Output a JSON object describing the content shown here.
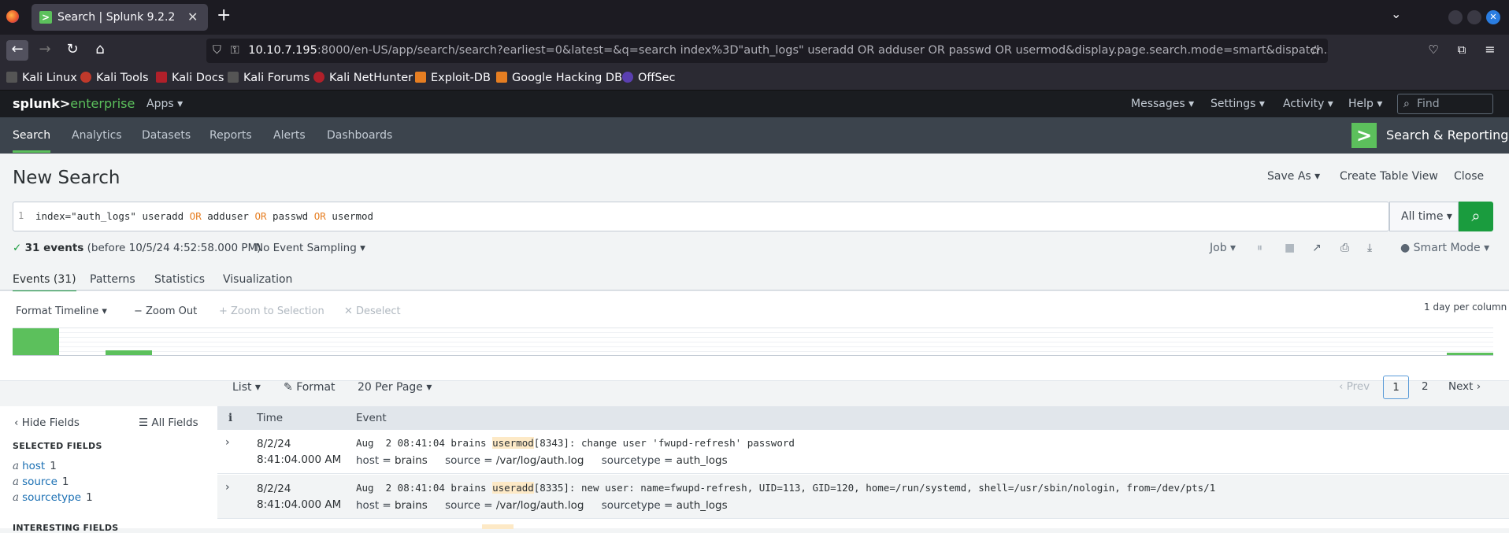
{
  "browser": {
    "tab_title": "Search | Splunk 9.2.2",
    "tab_favicon": ">",
    "tab_close": "✕",
    "new_tab": "+",
    "url_host": "10.10.7.195",
    "url_rest": ":8000/en-US/app/search/search?earliest=0&latest=&q=search index%3D\"auth_logs\" useradd OR adduser OR passwd OR usermod&display.page.search.mode=smart&dispatch.sample",
    "bookmarks": [
      "Kali Linux",
      "Kali Tools",
      "Kali Docs",
      "Kali Forums",
      "Kali NetHunter",
      "Exploit-DB",
      "Google Hacking DB",
      "OffSec"
    ]
  },
  "splunk_header": {
    "logo_left": "splunk>",
    "logo_right": "enterprise",
    "apps_menu": "Apps ▾",
    "messages": "Messages ▾",
    "settings": "Settings ▾",
    "activity": "Activity ▾",
    "help": "Help ▾",
    "find_placeholder": "Find"
  },
  "app_nav": {
    "items": [
      "Search",
      "Analytics",
      "Datasets",
      "Reports",
      "Alerts",
      "Dashboards"
    ],
    "app_title": "Search & Reporting",
    "app_icon": ">"
  },
  "search_page": {
    "title": "New Search",
    "save_as": "Save As ▾",
    "create_table_view": "Create Table View",
    "close": "Close",
    "line_number": "1",
    "query_parts": [
      "index=\"auth_logs\" useradd ",
      "OR",
      " adduser ",
      "OR",
      " passwd ",
      "OR",
      " usermod"
    ],
    "time_range": "All time ▾",
    "status_check": "✓",
    "status_count": "31 events",
    "status_detail": "(before 10/5/24 4:52:58.000 PM)",
    "sampling": "No Event Sampling ▾",
    "job_menu": "Job ▾",
    "smart_mode": "Smart Mode ▾",
    "tabs": [
      "Events (31)",
      "Patterns",
      "Statistics",
      "Visualization"
    ]
  },
  "timeline": {
    "format_timeline": "Format Timeline ▾",
    "zoom_out": "− Zoom Out",
    "zoom_to_selection": "+ Zoom to Selection",
    "deselect": "✕ Deselect",
    "scale_label": "1 day per column",
    "bars": [
      {
        "position": 0.0,
        "fraction": 1.0
      },
      {
        "position": 0.0625,
        "fraction": 0.18
      },
      {
        "position": 0.9685,
        "fraction": 0.1
      }
    ]
  },
  "results_toolbar": {
    "list": "List ▾",
    "format": "Format",
    "per_page": "20 Per Page ▾",
    "prev": "‹ Prev",
    "page_1": "1",
    "page_2": "2",
    "next": "Next ›"
  },
  "fields_sidebar": {
    "hide_fields": "Hide Fields",
    "all_fields": "All Fields",
    "selected_heading": "SELECTED FIELDS",
    "interesting_heading": "INTERESTING FIELDS",
    "selected": [
      {
        "type": "a",
        "name": "host",
        "count": "1"
      },
      {
        "type": "a",
        "name": "source",
        "count": "1"
      },
      {
        "type": "a",
        "name": "sourcetype",
        "count": "1"
      }
    ]
  },
  "events_table": {
    "col_info": "i",
    "col_time": "Time",
    "col_event": "Event",
    "rows": [
      {
        "date": "8/2/24",
        "time": "8:41:04.000 AM",
        "pre": "Aug  2 08:41:04 brains ",
        "hl": "usermod",
        "post": "[8343]: change user 'fwupd-refresh' password",
        "host": "brains",
        "source": "/var/log/auth.log",
        "sourcetype": "auth_logs"
      },
      {
        "date": "8/2/24",
        "time": "8:41:04.000 AM",
        "pre": "Aug  2 08:41:04 brains ",
        "hl": "useradd",
        "post": "[8335]: new user: name=fwupd-refresh, UID=113, GID=120, home=/run/systemd, shell=/usr/sbin/nologin, from=/dev/pts/1",
        "host": "brains",
        "source": "/var/log/auth.log",
        "sourcetype": "auth_logs"
      }
    ],
    "meta_labels": {
      "host": "host =",
      "source": "source =",
      "sourcetype": "sourcetype ="
    }
  }
}
